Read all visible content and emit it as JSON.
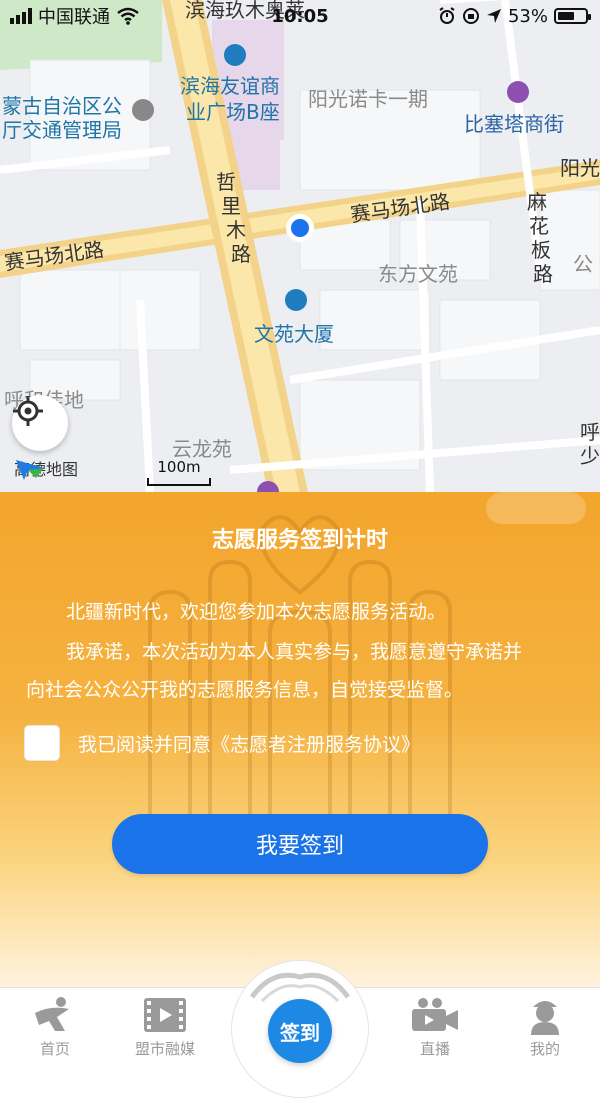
{
  "status_bar": {
    "carrier": "中国联通",
    "time": "10:05",
    "battery": "53%"
  },
  "map": {
    "labels": {
      "binhai_lmt": "滨海玖木奥莱",
      "binhai_youyi_1": "滨海友谊商",
      "binhai_youyi_2": "业广场B座",
      "yangguang_nuoka": "阳光诺卡一期",
      "bisaita": "比塞塔商街",
      "mengu_1": "蒙古自治区公",
      "mengu_2": "厅交通管理局",
      "yangguang_right": "阳光",
      "zhelimu_1": "哲",
      "zhelimu_2": "里",
      "zhelimu_3": "木",
      "zhelimu_4": "路",
      "saimachang_upper": "赛马场北路",
      "saimachang_left": "赛马场北路",
      "mahua_1": "麻",
      "mahua_2": "花",
      "mahua_3": "板",
      "mahua_4": "路",
      "dongfang": "东方文苑",
      "gong": "公",
      "wenyuan": "文苑大厦",
      "hehe": "呼和佳地",
      "yunlong": "云龙苑",
      "hu_1": "呼",
      "hu_2": "少"
    },
    "logo_text": "高德地图",
    "scale": "100m"
  },
  "panel": {
    "title": "志愿服务签到计时",
    "line1": "北疆新时代，欢迎您参加本次志愿服务活动。",
    "line2": "我承诺，本次活动为本人真实参与，我愿意遵守承诺并",
    "line3": "向社会公众公开我的志愿服务信息，自觉接受监督。",
    "checkbox_label": "我已阅读并同意《志愿者注册服务协议》",
    "button_label": "我要签到"
  },
  "tabbar": {
    "home": "首页",
    "media": "盟市融媒",
    "center": "签到",
    "live": "直播",
    "mine": "我的"
  },
  "colors": {
    "accent": "#1a73e8",
    "panel_orange": "#f3a52c"
  }
}
